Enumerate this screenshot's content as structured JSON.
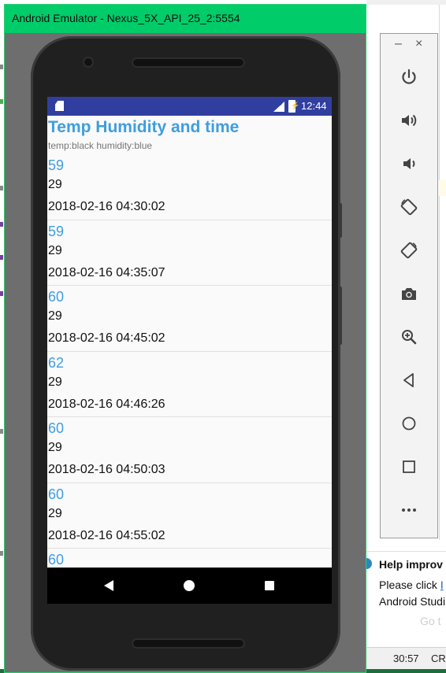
{
  "emulator": {
    "title": "Android Emulator - Nexus_5X_API_25_2:5554"
  },
  "statusbar": {
    "network": "4G",
    "time": "12:44"
  },
  "app": {
    "title": "Temp Humidity and time",
    "subtitle": "temp:black humidity:blue"
  },
  "readings": [
    {
      "temp": "59",
      "humidity": "29",
      "time": "2018-02-16 04:30:02"
    },
    {
      "temp": "59",
      "humidity": "29",
      "time": "2018-02-16 04:35:07"
    },
    {
      "temp": "60",
      "humidity": "29",
      "time": "2018-02-16 04:45:02"
    },
    {
      "temp": "62",
      "humidity": "29",
      "time": "2018-02-16 04:46:26"
    },
    {
      "temp": "60",
      "humidity": "29",
      "time": "2018-02-16 04:50:03"
    },
    {
      "temp": "60",
      "humidity": "29",
      "time": "2018-02-16 04:55:02"
    },
    {
      "temp": "60",
      "humidity": "",
      "time": ""
    }
  ],
  "toolbar": {
    "minimize": "–",
    "close": "×",
    "buttons": [
      "power-icon",
      "volume-up-icon",
      "volume-down-icon",
      "rotate-left-icon",
      "rotate-right-icon",
      "camera-icon",
      "zoom-icon",
      "back-icon",
      "home-icon",
      "overview-icon",
      "more-icon"
    ]
  },
  "notification": {
    "title": "Help improv",
    "line1_prefix": "Please click ",
    "line1_link": "I",
    "line2": "Android Studi",
    "ghost": "Go t"
  },
  "ide_status": {
    "position": "30:57",
    "encoding": "CR"
  },
  "colors": {
    "emulator_titlebar": "#00cc6a",
    "statusbar": "#303f9f",
    "accent_text": "#3e9ee0"
  }
}
